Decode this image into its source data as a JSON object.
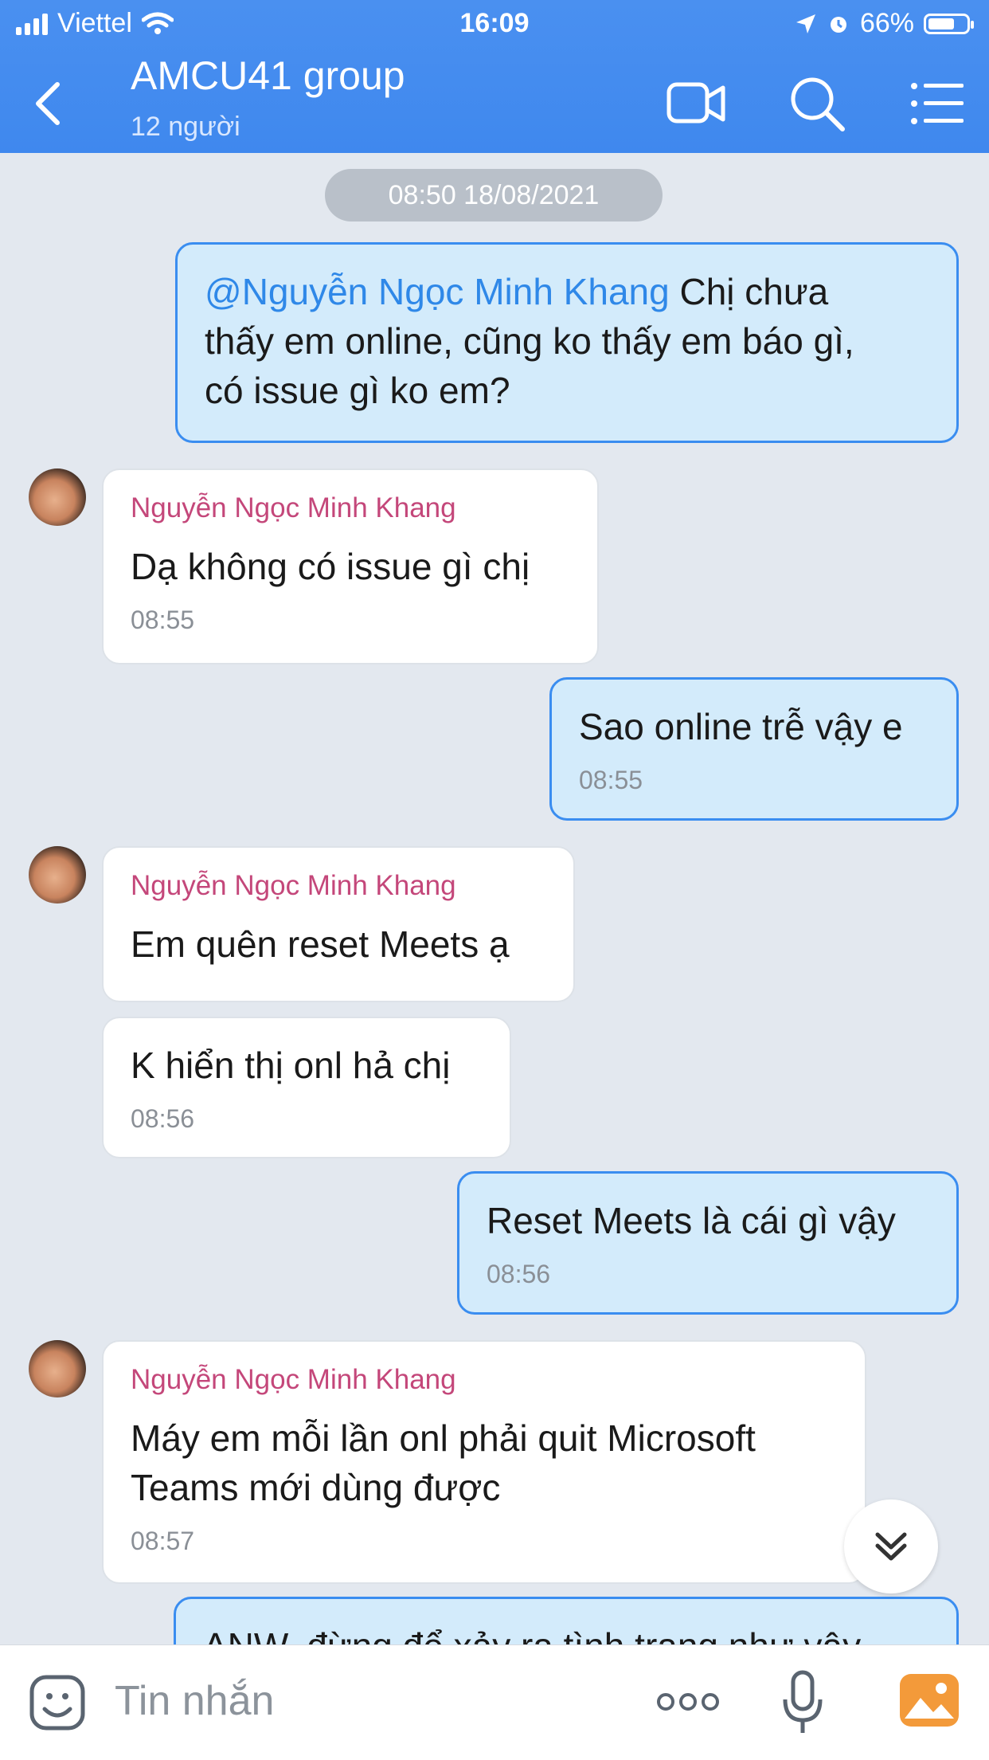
{
  "status": {
    "carrier": "Viettel",
    "time": "16:09",
    "battery": "66%"
  },
  "header": {
    "title": "AMCU41 group",
    "subtitle": "12 người"
  },
  "chat": {
    "date_chip": "08:50 18/08/2021",
    "messages": [
      {
        "mention": "@Nguyễn Ngọc Minh Khang",
        "text": " Chị chưa\nthấy em online, cũng ko thấy em báo gì,\ncó issue gì ko em?"
      },
      {
        "sender": "Nguyễn Ngọc Minh Khang",
        "text": "Dạ không có issue gì chị",
        "time": "08:55"
      },
      {
        "text": "Sao online trễ vậy e",
        "time": "08:55"
      },
      {
        "sender": "Nguyễn Ngọc Minh Khang",
        "text": "Em quên reset Meets ạ"
      },
      {
        "text": "K hiển thị onl hả chị",
        "time": "08:56"
      },
      {
        "text": "Reset Meets là cái gì vậy",
        "time": "08:56"
      },
      {
        "sender": "Nguyễn Ngọc Minh Khang",
        "text": "Máy em mỗi lần onl phải quit Microsoft\nTeams mới dùng được",
        "time": "08:57"
      },
      {
        "text": "ANW, đừng để xảy ra tình trạng như vậy"
      }
    ]
  },
  "composer": {
    "placeholder": "Tin nhắn"
  }
}
